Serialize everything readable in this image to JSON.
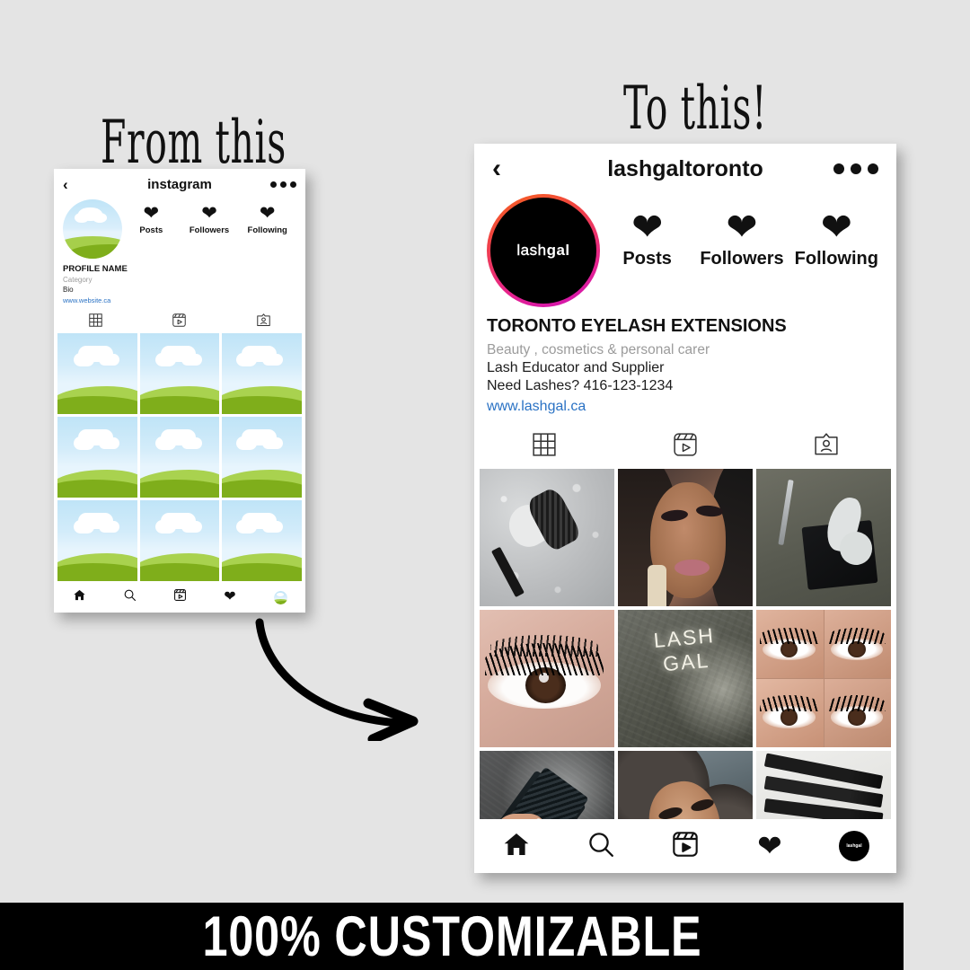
{
  "background_color": "#e4e4e4",
  "headings": {
    "from": "From this",
    "to": "To this!"
  },
  "banner": {
    "text": "100% CUSTOMIZABLE",
    "background_color": "#000000",
    "text_color": "#ffffff"
  },
  "arrow": {
    "name": "curved-arrow",
    "color": "#000000"
  },
  "phone_before": {
    "header": {
      "back": "‹",
      "handle": "instagram",
      "menu": "•••"
    },
    "avatar": {
      "type": "landscape-placeholder"
    },
    "stats": [
      {
        "icon": "heart-icon",
        "label": "Posts"
      },
      {
        "icon": "heart-icon",
        "label": "Followers"
      },
      {
        "icon": "heart-icon",
        "label": "Following"
      }
    ],
    "bio": {
      "name": "PROFILE NAME",
      "category": "Category",
      "lines": [
        "Bio"
      ],
      "link": "www.website.ca",
      "link_color": "#2a72c4",
      "category_color": "#9b9b9b"
    },
    "tabs": [
      {
        "icon": "grid-icon",
        "label": "Grid",
        "active": true
      },
      {
        "icon": "reels-icon",
        "label": "Reels",
        "active": false
      },
      {
        "icon": "tagged-icon",
        "label": "Tagged",
        "active": false
      }
    ],
    "grid": [
      {
        "alt": "placeholder-landscape"
      },
      {
        "alt": "placeholder-landscape"
      },
      {
        "alt": "placeholder-landscape"
      },
      {
        "alt": "placeholder-landscape"
      },
      {
        "alt": "placeholder-landscape"
      },
      {
        "alt": "placeholder-landscape"
      },
      {
        "alt": "placeholder-landscape"
      },
      {
        "alt": "placeholder-landscape"
      },
      {
        "alt": "placeholder-landscape"
      }
    ],
    "bottom_nav": [
      {
        "icon": "home-icon"
      },
      {
        "icon": "search-icon"
      },
      {
        "icon": "reels-icon"
      },
      {
        "icon": "heart-icon"
      },
      {
        "icon": "profile-avatar-icon"
      }
    ]
  },
  "phone_after": {
    "header": {
      "back": "‹",
      "handle": "lashgaltoronto",
      "menu": "•••"
    },
    "avatar": {
      "brand_thin": "lash",
      "brand_bold": "gal",
      "ring_gradient_start": "#f7651f",
      "ring_gradient_end": "#cd12b8",
      "background_color": "#000000"
    },
    "stats": [
      {
        "icon": "heart-icon",
        "label": "Posts"
      },
      {
        "icon": "heart-icon",
        "label": "Followers"
      },
      {
        "icon": "heart-icon",
        "label": "Following"
      }
    ],
    "bio": {
      "name": "TORONTO EYELASH EXTENSIONS",
      "category": "Beauty , cosmetics & personal carer",
      "lines": [
        "Lash Educator and Supplier",
        "Need Lashes? 416-123-1234"
      ],
      "link": "www.lashgal.ca",
      "link_color": "#2a72c4",
      "category_color": "#9b9b9b"
    },
    "tabs": [
      {
        "icon": "grid-icon",
        "label": "Grid",
        "active": true
      },
      {
        "icon": "reels-icon",
        "label": "Reels",
        "active": false
      },
      {
        "icon": "tagged-icon",
        "label": "Tagged",
        "active": false
      }
    ],
    "grid": [
      {
        "alt": "mascara-wand-on-wet-gray-surface"
      },
      {
        "alt": "woman-selfie-with-lash-extensions"
      },
      {
        "alt": "tweezers-and-eye-pads-on-black-tile"
      },
      {
        "alt": "closeup-eye-volume-lashes"
      },
      {
        "alt": "lash-gal-neon-sign-on-concrete-wall"
      },
      {
        "alt": "collage-of-four-lash-eyes"
      },
      {
        "alt": "hand-holding-lash-tweezers"
      },
      {
        "alt": "woman-with-curly-hair-lash-closeup"
      },
      {
        "alt": "row-of-lashgal-tweezers"
      }
    ],
    "bottom_nav": [
      {
        "icon": "home-icon"
      },
      {
        "icon": "search-icon"
      },
      {
        "icon": "reels-icon"
      },
      {
        "icon": "heart-icon"
      },
      {
        "icon": "profile-avatar-icon"
      }
    ]
  }
}
